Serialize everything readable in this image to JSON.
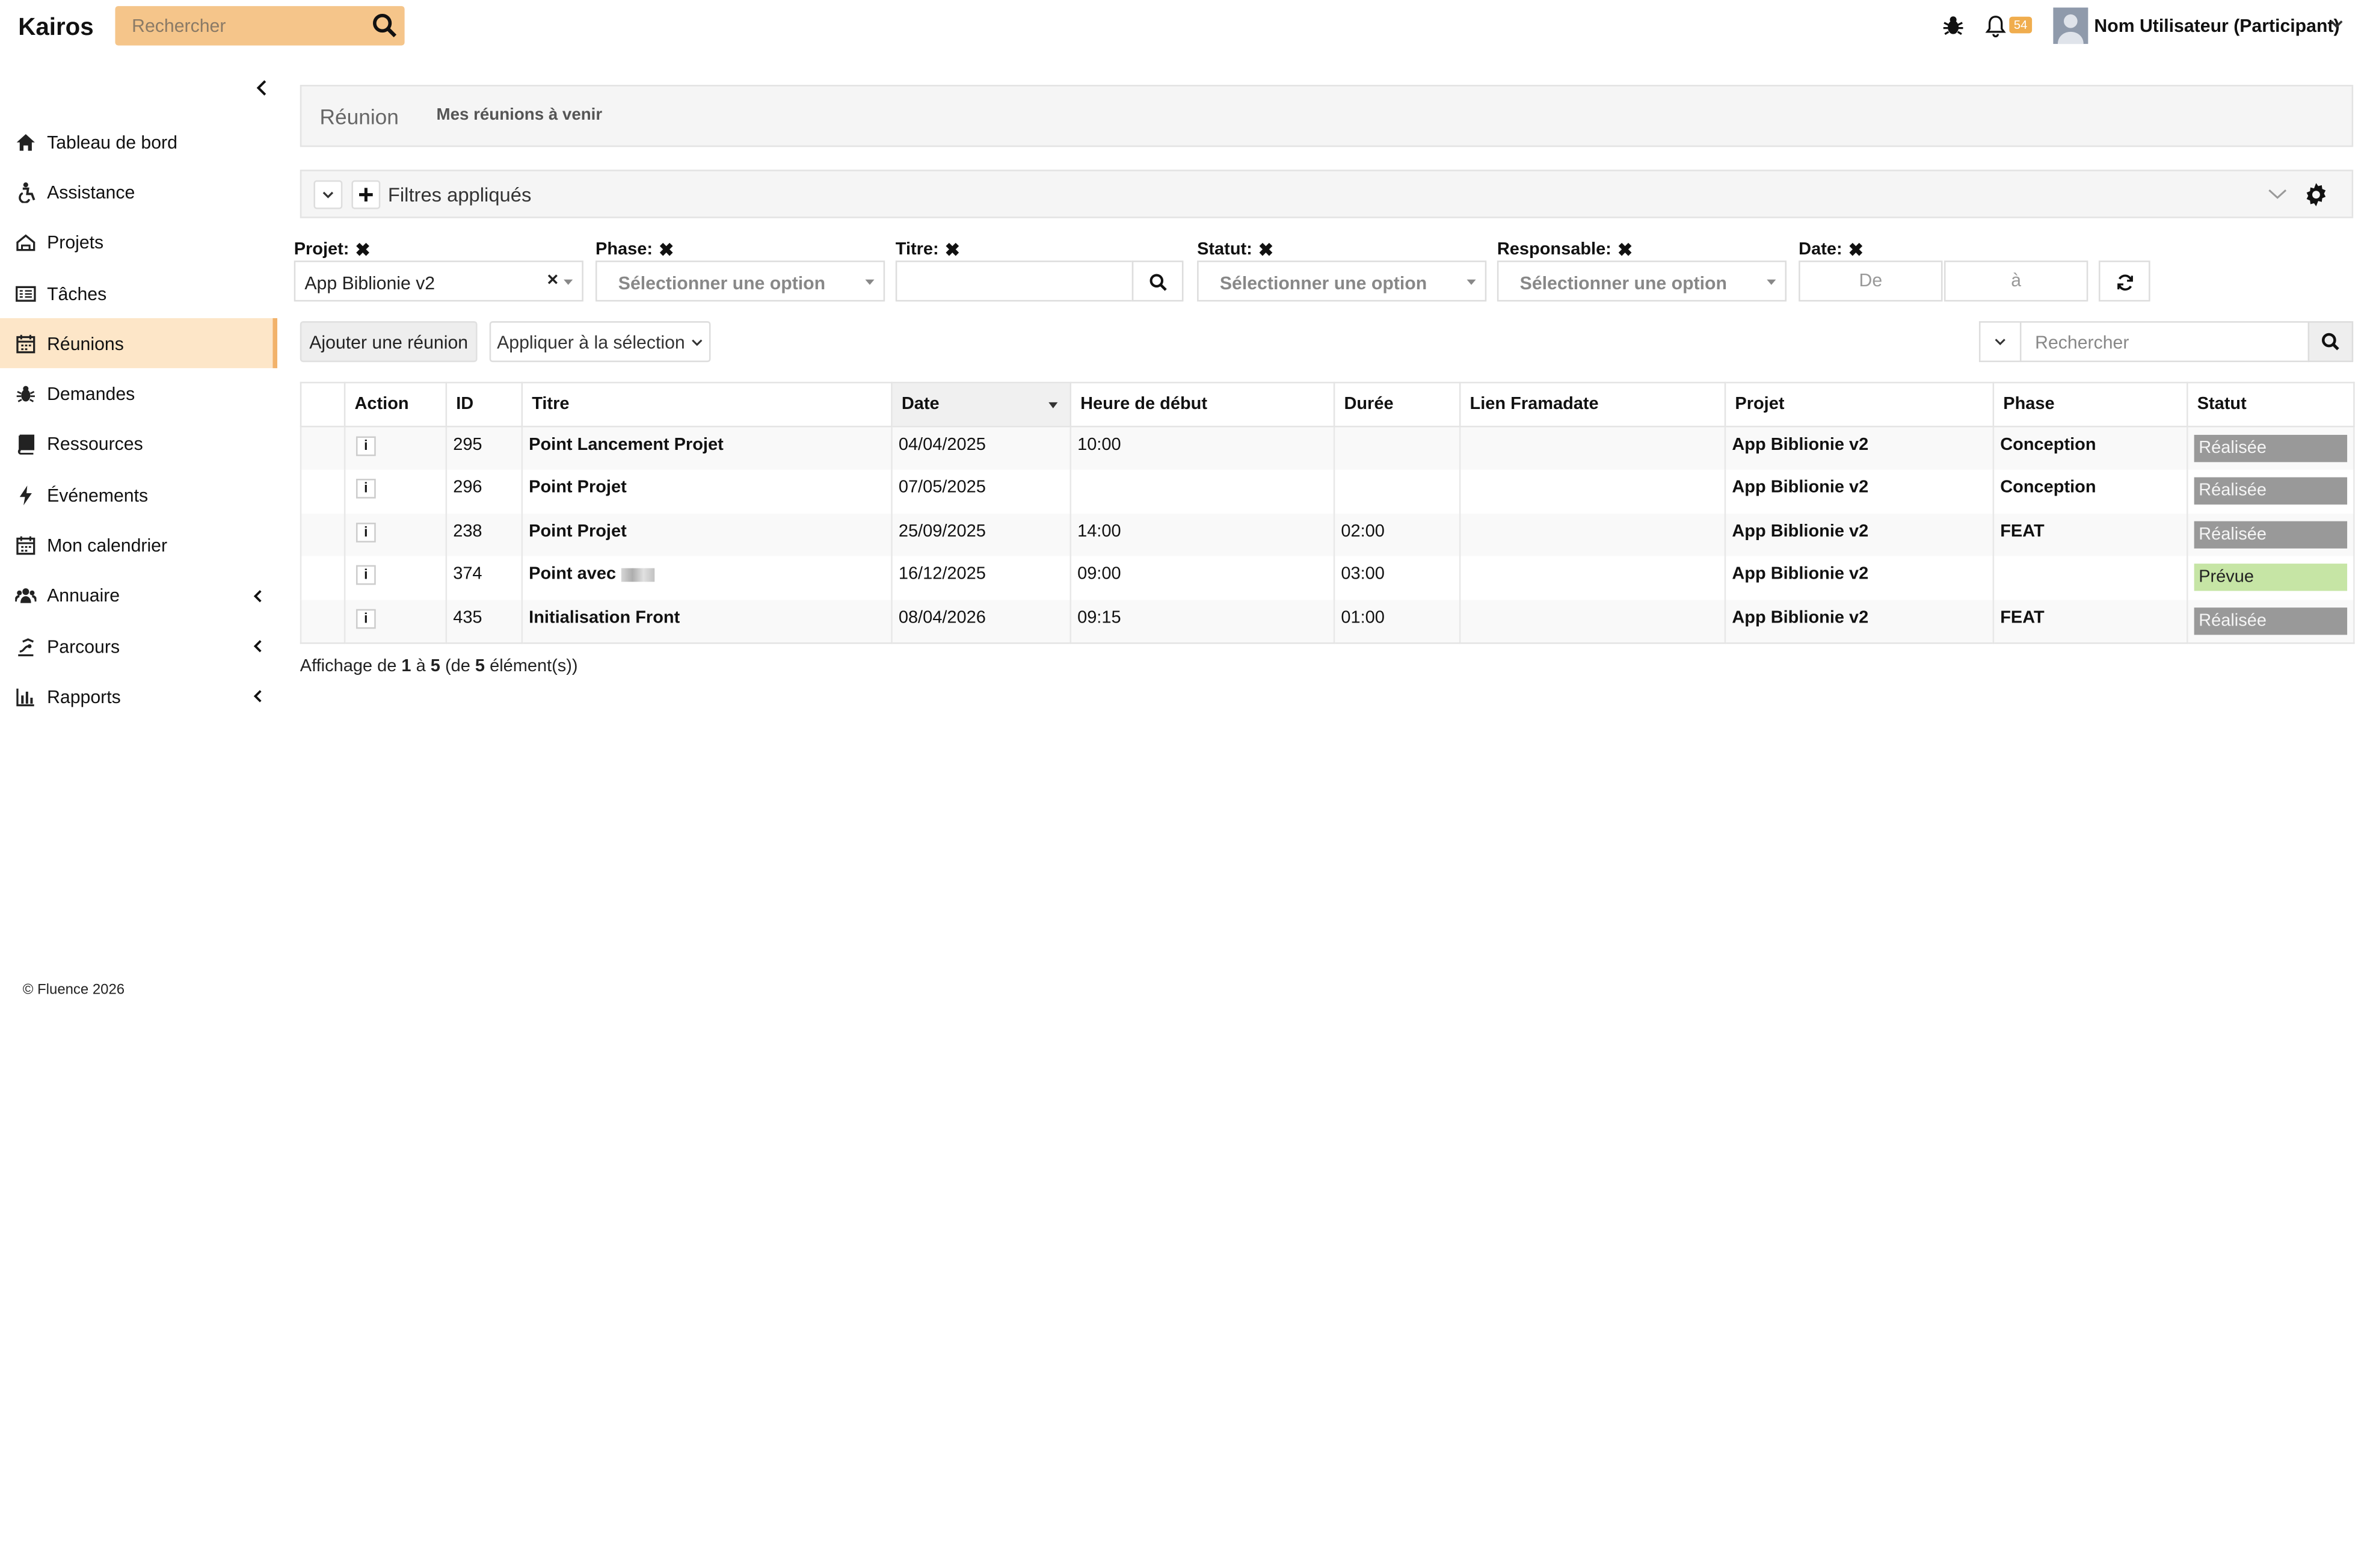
{
  "app": {
    "title": "Kairos"
  },
  "topbar": {
    "search_placeholder": "Rechercher",
    "notifications_count": "54",
    "user_name": "Nom Utilisateur (Participant)"
  },
  "sidebar": {
    "items": [
      {
        "label": "Tableau de bord",
        "icon": "home-icon"
      },
      {
        "label": "Assistance",
        "icon": "accessibility-icon"
      },
      {
        "label": "Projets",
        "icon": "projects-icon"
      },
      {
        "label": "Tâches",
        "icon": "tasks-icon"
      },
      {
        "label": "Réunions",
        "icon": "calendar-icon",
        "active": true
      },
      {
        "label": "Demandes",
        "icon": "bug-icon"
      },
      {
        "label": "Ressources",
        "icon": "book-icon"
      },
      {
        "label": "Événements",
        "icon": "bolt-icon"
      },
      {
        "label": "Mon calendrier",
        "icon": "calendar-icon"
      },
      {
        "label": "Annuaire",
        "icon": "users-icon",
        "expandable": true
      },
      {
        "label": "Parcours",
        "icon": "route-icon",
        "expandable": true
      },
      {
        "label": "Rapports",
        "icon": "bar-chart-icon",
        "expandable": true
      }
    ],
    "footer": "© Fluence 2026"
  },
  "header": {
    "title": "Réunion",
    "subtitle": "Mes réunions à venir"
  },
  "filters": {
    "bar_label": "Filtres appliqués",
    "projet": {
      "label": "Projet:",
      "value": "App Biblionie v2"
    },
    "phase": {
      "label": "Phase:",
      "placeholder": "Sélectionner une option"
    },
    "titre": {
      "label": "Titre:",
      "value": ""
    },
    "statut": {
      "label": "Statut:",
      "placeholder": "Sélectionner une option"
    },
    "responsable": {
      "label": "Responsable:",
      "placeholder": "Sélectionner une option"
    },
    "date": {
      "label": "Date:",
      "from_placeholder": "De",
      "to_placeholder": "à"
    }
  },
  "toolbar": {
    "add_label": "Ajouter une réunion",
    "apply_label": "Appliquer à la sélection",
    "search_placeholder": "Rechercher"
  },
  "table": {
    "columns": [
      "",
      "Action",
      "ID",
      "Titre",
      "Date",
      "Heure de début",
      "Durée",
      "Lien Framadate",
      "Projet",
      "Phase",
      "Statut"
    ],
    "sorted_column": "Date",
    "rows": [
      {
        "id": "295",
        "titre": "Point Lancement Projet",
        "date": "04/04/2025",
        "heure": "10:00",
        "duree": "",
        "lien": "",
        "projet": "App Biblionie v2",
        "phase": "Conception",
        "statut": "Réalisée",
        "statut_kind": "done"
      },
      {
        "id": "296",
        "titre": "Point Projet",
        "date": "07/05/2025",
        "heure": "",
        "duree": "",
        "lien": "",
        "projet": "App Biblionie v2",
        "phase": "Conception",
        "statut": "Réalisée",
        "statut_kind": "done"
      },
      {
        "id": "238",
        "titre": "Point Projet",
        "date": "25/09/2025",
        "heure": "14:00",
        "duree": "02:00",
        "lien": "",
        "projet": "App Biblionie v2",
        "phase": "FEAT",
        "statut": "Réalisée",
        "statut_kind": "done"
      },
      {
        "id": "374",
        "titre": "Point avec",
        "date": "16/12/2025",
        "heure": "09:00",
        "duree": "03:00",
        "lien": "",
        "projet": "App Biblionie v2",
        "phase": "",
        "statut": "Prévue",
        "statut_kind": "planned"
      },
      {
        "id": "435",
        "titre": "Initialisation Front",
        "date": "08/04/2026",
        "heure": "09:15",
        "duree": "01:00",
        "lien": "",
        "projet": "App Biblionie v2",
        "phase": "FEAT",
        "statut": "Réalisée",
        "statut_kind": "done"
      }
    ]
  },
  "summary": {
    "prefix": "Affichage de ",
    "from": "1",
    "mid1": " à ",
    "to": "5",
    "mid2": " (de ",
    "total": "5",
    "suffix": " élément(s))"
  },
  "colors": {
    "accent": "#f5c58a",
    "active_bg": "#fde6c8",
    "status_done": "#999999",
    "status_planned": "#c6e5a5",
    "badge": "#f0ad4e"
  }
}
